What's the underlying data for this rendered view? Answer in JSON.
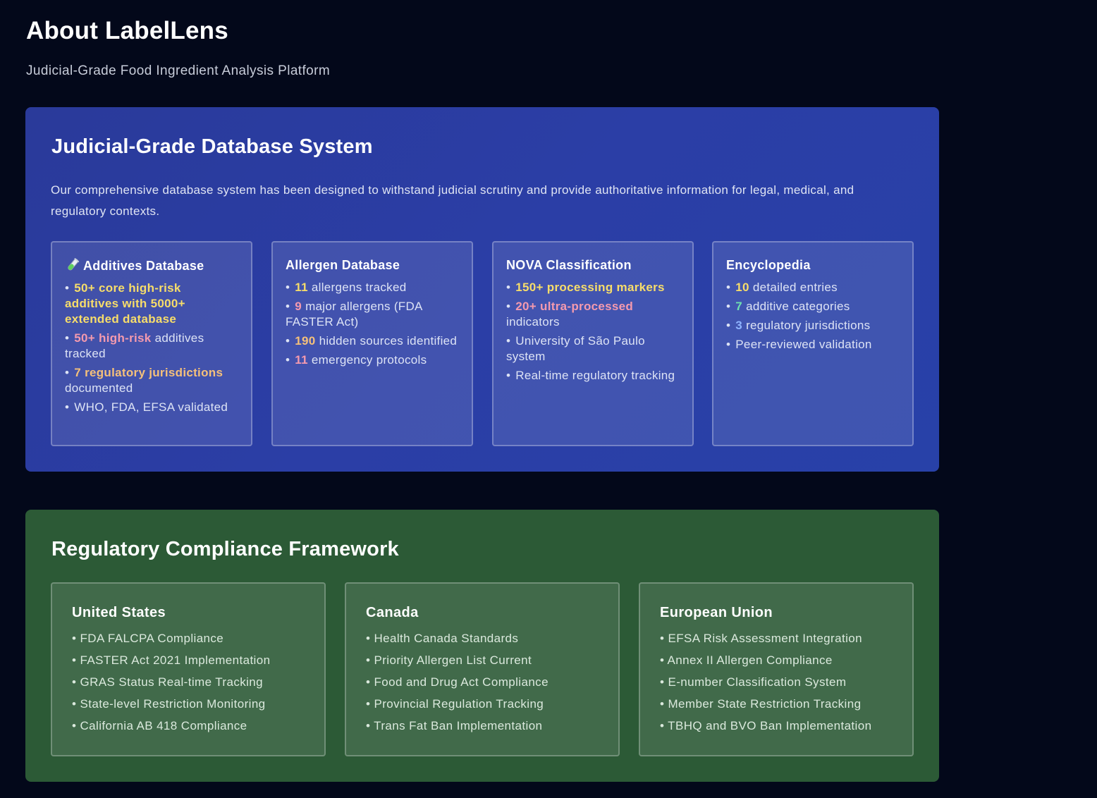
{
  "header": {
    "title": "About LabelLens",
    "subtitle": "Judicial-Grade Food Ingredient Analysis Platform"
  },
  "database_section": {
    "title": "Judicial-Grade Database System",
    "description": "Our comprehensive database system has been designed to withstand judicial scrutiny and provide authoritative information for legal, medical, and regulatory contexts.",
    "cards": [
      {
        "icon": "test-tube-icon",
        "title": "Additives Database",
        "items": [
          {
            "highlight": "50+ core high-risk additives with 5000+ extended database",
            "rest": ""
          },
          {
            "highlight": "50+ high-risk",
            "rest": " additives tracked"
          },
          {
            "highlight": "7 regulatory jurisdictions",
            "rest": " documented"
          },
          {
            "highlight": "",
            "rest": "WHO, FDA, EFSA validated"
          }
        ]
      },
      {
        "title": "Allergen Database",
        "items": [
          {
            "highlight": "11",
            "rest": " allergens tracked"
          },
          {
            "highlight": "9",
            "rest": " major allergens (FDA FASTER Act)"
          },
          {
            "highlight": "190",
            "rest": " hidden sources identified"
          },
          {
            "highlight": "11",
            "rest": " emergency protocols"
          }
        ]
      },
      {
        "title": "NOVA Classification",
        "items": [
          {
            "highlight": "150+ processing markers",
            "rest": ""
          },
          {
            "highlight": "20+ ultra-processed",
            "rest": " indicators"
          },
          {
            "highlight": "",
            "rest": "University of São Paulo system"
          },
          {
            "highlight": "",
            "rest": "Real-time regulatory tracking"
          }
        ]
      },
      {
        "title": "Encyclopedia",
        "items": [
          {
            "highlight": "10",
            "rest": " detailed entries"
          },
          {
            "highlight": "7",
            "rest": " additive categories"
          },
          {
            "highlight": "3",
            "rest": " regulatory jurisdictions"
          },
          {
            "highlight": "",
            "rest": "Peer-reviewed validation"
          }
        ]
      }
    ]
  },
  "regulatory_section": {
    "title": "Regulatory Compliance Framework",
    "cards": [
      {
        "title": "United States",
        "items": [
          "FDA FALCPA Compliance",
          "FASTER Act 2021 Implementation",
          "GRAS Status Real-time Tracking",
          "State-level Restriction Monitoring",
          "California AB 418 Compliance"
        ]
      },
      {
        "title": "Canada",
        "items": [
          "Health Canada Standards",
          "Priority Allergen List Current",
          "Food and Drug Act Compliance",
          "Provincial Regulation Tracking",
          "Trans Fat Ban Implementation"
        ]
      },
      {
        "title": "European Union",
        "items": [
          "EFSA Risk Assessment Integration",
          "Annex II Allergen Compliance",
          "E-number Classification System",
          "Member State Restriction Tracking",
          "TBHQ and BVO Ban Implementation"
        ]
      }
    ]
  },
  "colors": {
    "background": "#03081a",
    "database_panel": "#2b3ea6",
    "regulatory_panel": "#2c5a36",
    "highlight_yellow": "#f7dd6a",
    "highlight_pink": "#f49aae",
    "highlight_orange": "#f5c07a",
    "highlight_green": "#6fe0b0",
    "highlight_blue": "#8fb4ff"
  }
}
